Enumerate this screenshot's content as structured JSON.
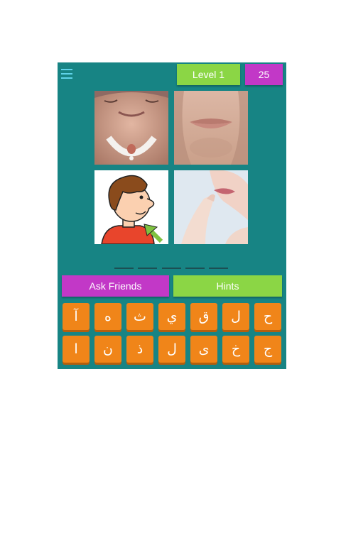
{
  "header": {
    "level_label": "Level 1",
    "coins": "25"
  },
  "images": [
    {
      "subject": "chin from below with dental bib"
    },
    {
      "subject": "man's lips and chin"
    },
    {
      "subject": "cartoon boy pointing at chin"
    },
    {
      "subject": "woman touching lips"
    }
  ],
  "answer": {
    "slot_count": 5
  },
  "actions": {
    "ask_friends": "Ask Friends",
    "hints": "Hints"
  },
  "keyboard": {
    "row1": [
      "آ",
      "ه",
      "ث",
      "ي",
      "ق",
      "ل",
      "ح"
    ],
    "row2": [
      "ا",
      "ن",
      "ذ",
      "ل",
      "ى",
      "خ",
      "ج"
    ]
  },
  "colors": {
    "background": "#178484",
    "green": "#8bd645",
    "purple": "#c238c7",
    "key": "#f08519"
  }
}
